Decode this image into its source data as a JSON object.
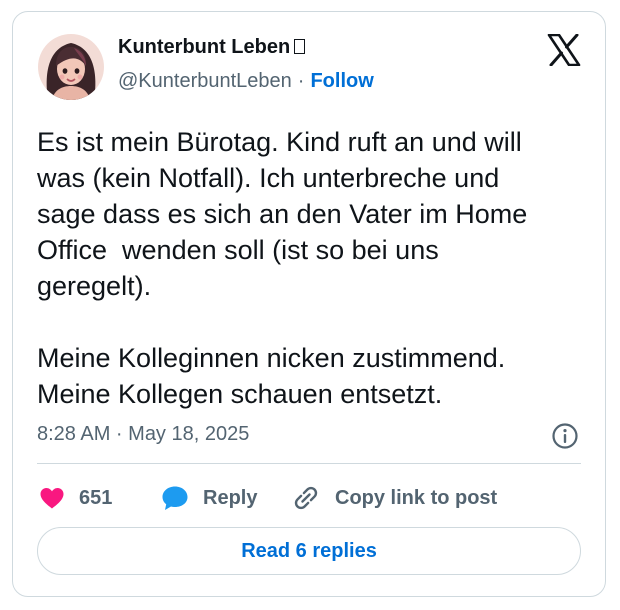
{
  "author": {
    "display_name": "Kunterbunt Leben",
    "handle": "@KunterbuntLeben",
    "separator": "·",
    "follow_label": "Follow"
  },
  "tweet": {
    "text": "Es ist mein Bürotag. Kind ruft an und will\nwas (kein Notfall). Ich unterbreche und\nsage dass es sich an den Vater im Home\nOffice  wenden soll (ist so bei uns\ngeregelt).\n\nMeine Kolleginnen nicken zustimmend.\nMeine Kollegen schauen entsetzt.",
    "timestamp": "8:28 AM · May 18, 2025"
  },
  "actions": {
    "like_count": "651",
    "reply_label": "Reply",
    "copy_link_label": "Copy link to post"
  },
  "footer": {
    "read_replies_label": "Read 6 replies"
  },
  "icons": {
    "brand": "x-logo-icon",
    "like": "heart-icon",
    "reply": "speech-bubble-icon",
    "copy": "link-icon",
    "info": "info-icon"
  },
  "colors": {
    "like": "#f91880",
    "reply": "#1d9bf0",
    "link_blue": "#006fd6",
    "text": "#0f1419",
    "muted": "#536471",
    "border": "#cfd9de"
  }
}
